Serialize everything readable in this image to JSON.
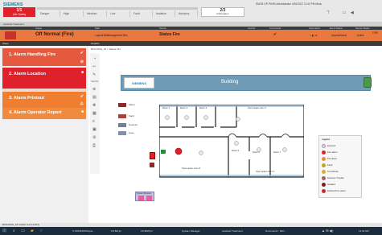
{
  "header": {
    "brand": "SIEMENS",
    "life_safety": {
      "count": "1/1",
      "label": "Life Safety"
    },
    "categories": [
      "Danger",
      "High",
      "Medium",
      "Low",
      "Fault",
      "Isolation",
      "Advisory"
    ],
    "information": {
      "count": "2/3",
      "label": "Information"
    },
    "user_line": "ENGR-OP-PKHE  Administrator  4/20/2017 11:42 PM   Menu",
    "tab_label": "Assisted Treatment"
  },
  "event_table": {
    "headers": [
      "Cause",
      "Path",
      "Source",
      "Control",
      "Commands",
      "Information",
      "Event Status",
      "Source Status"
    ],
    "row": {
      "title": "Off Normal (Fire)",
      "path": "Logical.BldManagement.Bld...",
      "source": "Status Fire",
      "check": "✔",
      "status": "Unprocessed",
      "source_status": "Active",
      "fire_label": "FIRE"
    }
  },
  "left_panel": {
    "title": "Steps",
    "steps": [
      {
        "label": "1. Alarm Handling Fire",
        "state_icon": "✔",
        "extra_icon": "⊘"
      },
      {
        "label": "2. Alarm Location",
        "state_icon": "■",
        "extra_icon": ""
      },
      {
        "label": "3. Alarm Printout",
        "state_icon": "✔",
        "extra_icon": "⚠"
      },
      {
        "label": "4. Alarm Operator Report",
        "state_icon": "■",
        "extra_icon": ""
      }
    ]
  },
  "right_panel": {
    "title": "Graphic",
    "breadcrumb": "BUILDING_01 > Status Fire",
    "toolbar_labels": [
      "SHOW"
    ],
    "building_logo": "SIEMENS",
    "building_title": "Building",
    "mini_legend": [
      "Alarm",
      "Fault",
      "Detector",
      "Area"
    ]
  },
  "floor_rooms": [
    "Room 1",
    "Room 2",
    "Room 3",
    "Open space room 4",
    "Room 5",
    "Room 6",
    "Room 7",
    "Open space room 8",
    "Open space room 9"
  ],
  "legend": {
    "title": "Legend",
    "items": [
      "Detector",
      "Fire alarm",
      "Pre alarm",
      "Fault",
      "Ten-Minute",
      "Detector Trouble",
      "Isolated",
      "Defined Fire alarm"
    ]
  },
  "system_box_label": "System Browser",
  "statusbar_text": "BUILDING_01 loaded successfully",
  "taskbar": {
    "items": [
      "C:\\WINDOWS\\syst...",
      "FS Bld.jrn",
      "FS Bld5.jrn",
      "System Manager",
      "Assisted Treatment",
      "Document1 - Micr..."
    ],
    "clock": "11:44 AM"
  },
  "colors": {
    "alarm_red": "#e0202a",
    "event_orange": "#e8783e",
    "step_red": "#e55a3e",
    "step_orange": "#f07e30",
    "building_blue": "#6e9bb6"
  }
}
